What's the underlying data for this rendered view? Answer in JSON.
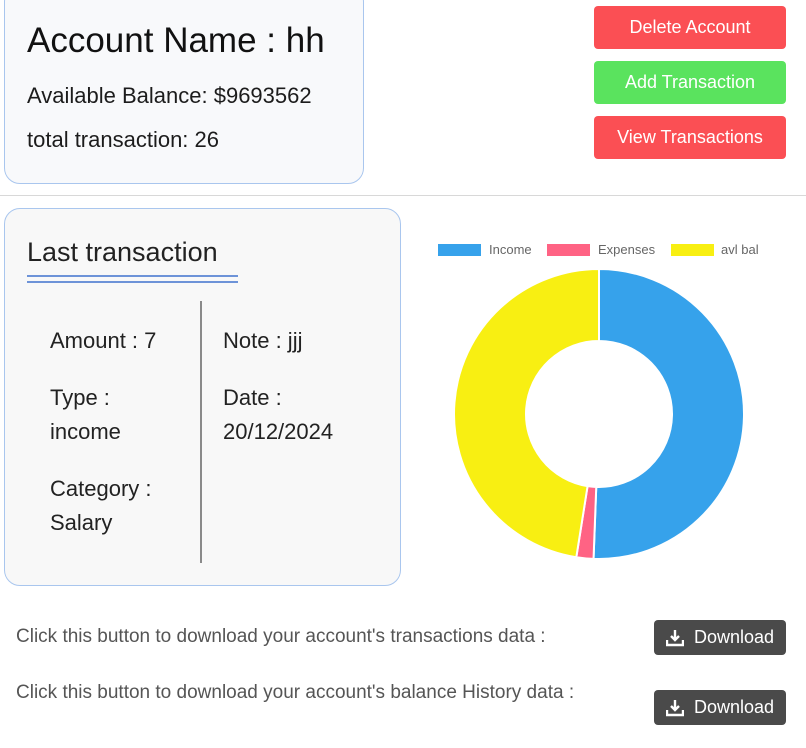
{
  "account": {
    "name_line": "Account Name : hh",
    "balance_line": "Available Balance: $9693562",
    "transaction_count_line": "total transaction: 26"
  },
  "actions": {
    "delete_label": "Delete Account",
    "add_label": "Add Transaction",
    "view_label": "View Transactions",
    "delete_color": "#fb4f54",
    "add_color": "#5ae35e",
    "view_color": "#fb4f54"
  },
  "last_transaction": {
    "title": "Last transaction",
    "amount": "Amount : 7",
    "type": "Type : income",
    "category": "Category : Salary",
    "note": "Note : jjj",
    "date": "Date : 20/12/2024"
  },
  "chart_data": {
    "type": "pie",
    "variant": "doughnut",
    "legend_position": "top",
    "categories": [
      "Income",
      "Expenses",
      "avl bal"
    ],
    "values": [
      50.6,
      1.9,
      47.5
    ],
    "colors": [
      "#36a2eb",
      "#ff6384",
      "#f8ef12"
    ],
    "title": ""
  },
  "downloads": {
    "transactions_text": "Click this button to download your account's transactions data :",
    "balance_text": "Click this button to download your account's balance History data :",
    "button_label": "Download",
    "icon": "download-icon"
  }
}
